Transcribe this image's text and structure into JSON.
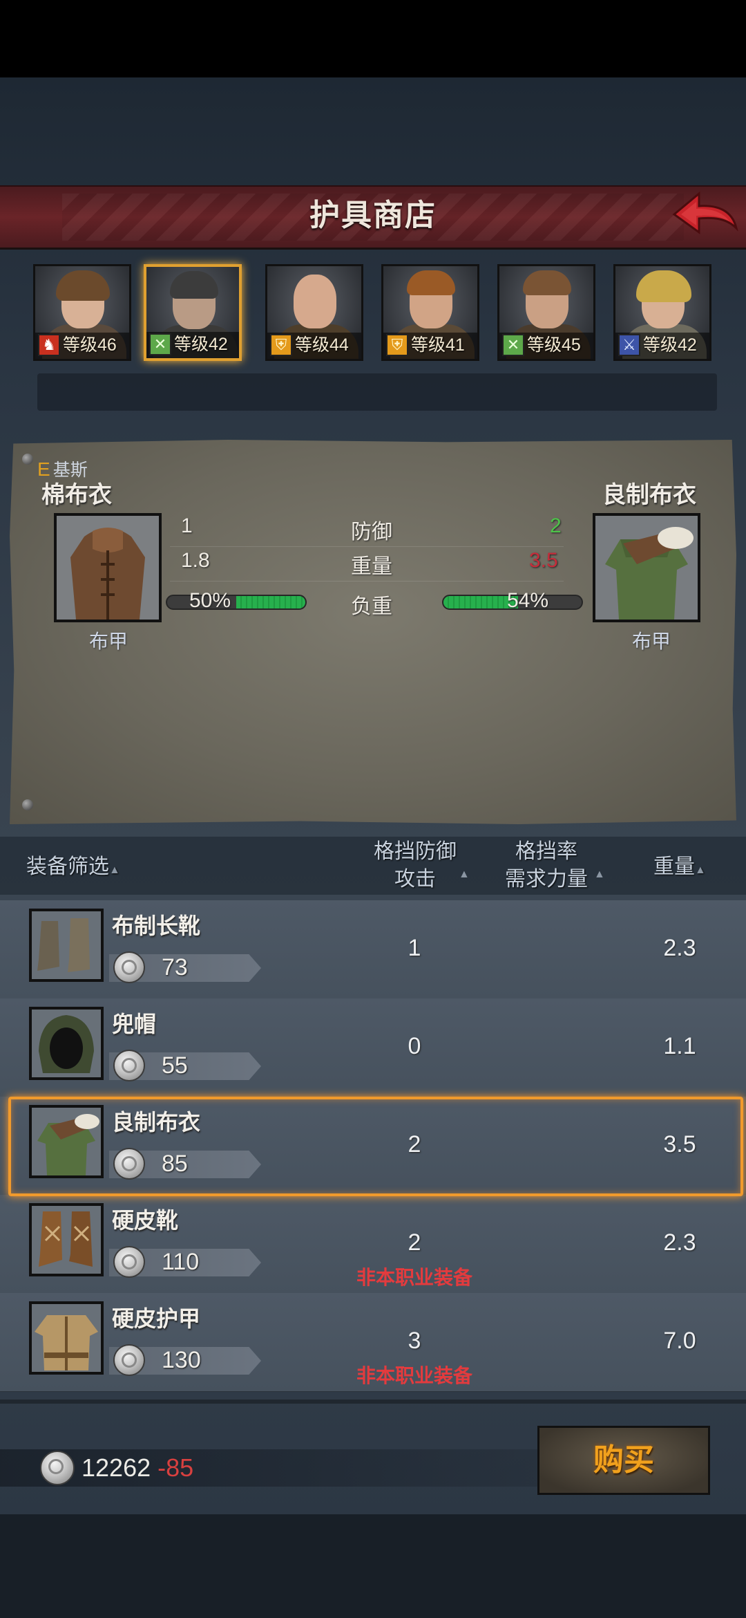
{
  "header": {
    "title": "护具商店"
  },
  "heroes": [
    {
      "level_label": "等级46",
      "class_icon": "horse-icon",
      "class_color": "#c9301f"
    },
    {
      "level_label": "等级42",
      "class_icon": "crossed-swords-icon",
      "class_color": "#5da84a",
      "selected": true
    },
    {
      "level_label": "等级44",
      "class_icon": "shield-icon",
      "class_color": "#e49a1b"
    },
    {
      "level_label": "等级41",
      "class_icon": "shield-icon",
      "class_color": "#e49a1b"
    },
    {
      "level_label": "等级45",
      "class_icon": "crossed-swords-icon",
      "class_color": "#5da84a"
    },
    {
      "level_label": "等级42",
      "class_icon": "sword-icon",
      "class_color": "#3d54a8"
    }
  ],
  "compare": {
    "hero_rank": "E",
    "hero_name": "基斯",
    "current": {
      "name": "棉布衣",
      "type": "布甲",
      "defense": "1",
      "weight": "1.8",
      "load": "50%",
      "load_fraction": 0.5
    },
    "new": {
      "name": "良制布衣",
      "type": "布甲",
      "defense": "2",
      "weight": "3.5",
      "load": "54%",
      "load_fraction": 0.54
    },
    "labels": {
      "defense": "防御",
      "weight": "重量",
      "load": "负重"
    }
  },
  "table": {
    "headers": {
      "filter": "装备筛选",
      "col1_top": "格挡防御",
      "col1_bottom": "攻击",
      "col2_top": "格挡率",
      "col2_bottom": "需求力量",
      "col3": "重量"
    },
    "rows": [
      {
        "name": "布制长靴",
        "price": "73",
        "value": "1",
        "weight": "2.3",
        "warning": ""
      },
      {
        "name": "兜帽",
        "price": "55",
        "value": "0",
        "weight": "1.1",
        "warning": ""
      },
      {
        "name": "良制布衣",
        "price": "85",
        "value": "2",
        "weight": "3.5",
        "warning": "",
        "selected": true
      },
      {
        "name": "硬皮靴",
        "price": "110",
        "value": "2",
        "weight": "2.3",
        "warning": "非本职业装备"
      },
      {
        "name": "硬皮护甲",
        "price": "130",
        "value": "3",
        "weight": "7.0",
        "warning": "非本职业装备"
      }
    ]
  },
  "footer": {
    "money": "12262",
    "cost": "-85",
    "buy_label": "购买"
  },
  "colors": {
    "accent": "#f19a2c",
    "buy_text": "#f1a11d",
    "increase": "#4ec44a",
    "decrease": "#c52c3a",
    "warning": "#e33b3e"
  }
}
